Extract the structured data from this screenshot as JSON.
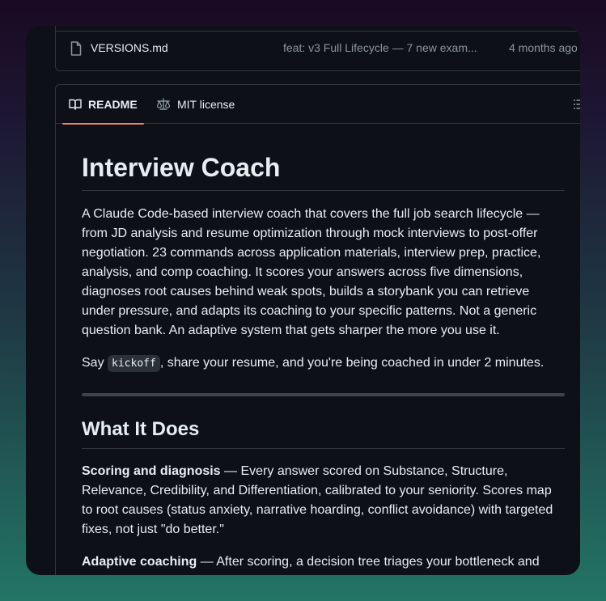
{
  "files": {
    "rows": [
      {
        "name": "VERSIONS.md",
        "message": "feat: v3 Full Lifecycle — 7 new exam...",
        "time": "4 months ago"
      }
    ]
  },
  "readme": {
    "tabs": {
      "readme": "README",
      "license": "MIT license"
    },
    "title": "Interview Coach",
    "intro": "A Claude Code-based interview coach that covers the full job search lifecycle — from JD analysis and resume optimization through mock interviews to post-offer negotiation. 23 commands across application materials, interview prep, practice, analysis, and comp coaching. It scores your answers across five dimensions, diagnoses root causes behind weak spots, builds a storybank you can retrieve under pressure, and adapts its coaching to your specific patterns. Not a generic question bank. An adaptive system that gets sharper the more you use it.",
    "say_prefix": "Say ",
    "say_code": "kickoff",
    "say_suffix": ", share your resume, and you're being coached in under 2 minutes.",
    "section_title": "What It Does",
    "scoring_label": "Scoring and diagnosis",
    "scoring_text": " — Every answer scored on Substance, Structure, Relevance, Credibility, and Differentiation, calibrated to your seniority. Scores map to root causes (status anxiety, narrative hoarding, conflict avoidance) with targeted fixes, not just \"do better.\"",
    "adaptive_label": "Adaptive coaching",
    "adaptive_text": " — After scoring, a decision tree triages your bottleneck and branches to the right drill. If Relevance is your gap, you get question-decoding"
  },
  "colors": {
    "accent": "#f78166",
    "bg": "#0d1117",
    "border": "#30363d",
    "text": "#e6edf3",
    "muted": "#8b949e"
  },
  "icons": {
    "file": "file-icon",
    "book": "book-icon",
    "law": "law-icon",
    "toc": "list-icon"
  }
}
